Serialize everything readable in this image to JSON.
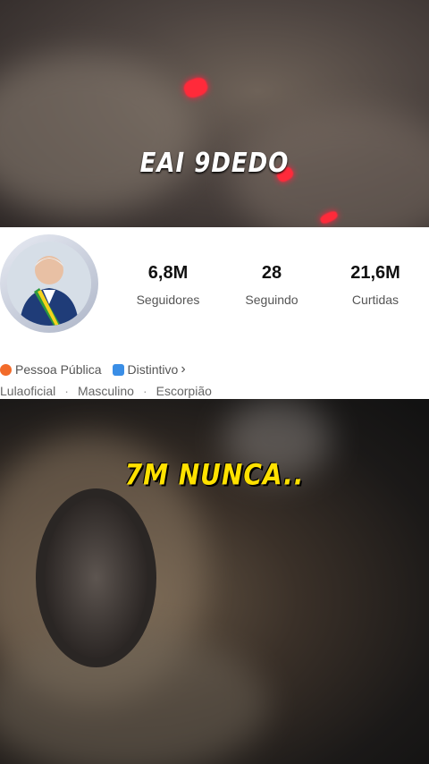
{
  "captions": {
    "top": "EAI 9DEDO",
    "bottom": "7M NUNCA.."
  },
  "profile": {
    "stats": [
      {
        "value": "6,8M",
        "label": "Seguidores"
      },
      {
        "value": "28",
        "label": "Seguindo"
      },
      {
        "value": "21,6M",
        "label": "Curtidas"
      }
    ],
    "tags": {
      "public_figure": "Pessoa Pública",
      "badge": "Distintivo",
      "chevron": "›"
    },
    "meta": {
      "username": "Lulaoficial",
      "gender": "Masculino",
      "sign": "Escorpião",
      "separator": "·"
    }
  },
  "colors": {
    "caption_top": "#ffffff",
    "caption_bottom": "#ffe100",
    "public_icon": "#f26b2a",
    "badge_icon": "#3a8ee6"
  }
}
